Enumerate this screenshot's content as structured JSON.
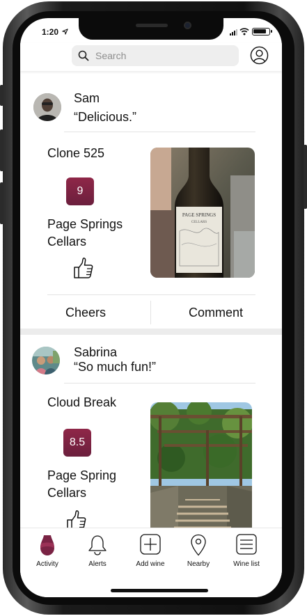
{
  "status_bar": {
    "time": "1:20"
  },
  "search": {
    "placeholder": "Search"
  },
  "feed": {
    "posts": [
      {
        "user": "Sam",
        "comment": "“Delicious.”",
        "wine": "Clone 525",
        "score": "9",
        "winery_line1": "Page Springs",
        "winery_line2": "Cellars",
        "cheers_label": "Cheers",
        "comment_label": "Comment"
      },
      {
        "user": "Sabrina",
        "comment": "“So much fun!”",
        "wine": "Cloud Break",
        "score": "8.5",
        "winery_line1": "Page Spring",
        "winery_line2": "Cellars"
      }
    ]
  },
  "tabs": [
    {
      "label": "Activity",
      "icon": "wine-glass-icon",
      "active": true
    },
    {
      "label": "Alerts",
      "icon": "bell-icon"
    },
    {
      "label": "Add wine",
      "icon": "plus-square-icon"
    },
    {
      "label": "Nearby",
      "icon": "map-pin-icon"
    },
    {
      "label": "Wine list",
      "icon": "list-icon"
    }
  ],
  "colors": {
    "accent": "#7a2344",
    "badge_top": "#8f2748",
    "badge_bottom": "#6b1f3d"
  }
}
